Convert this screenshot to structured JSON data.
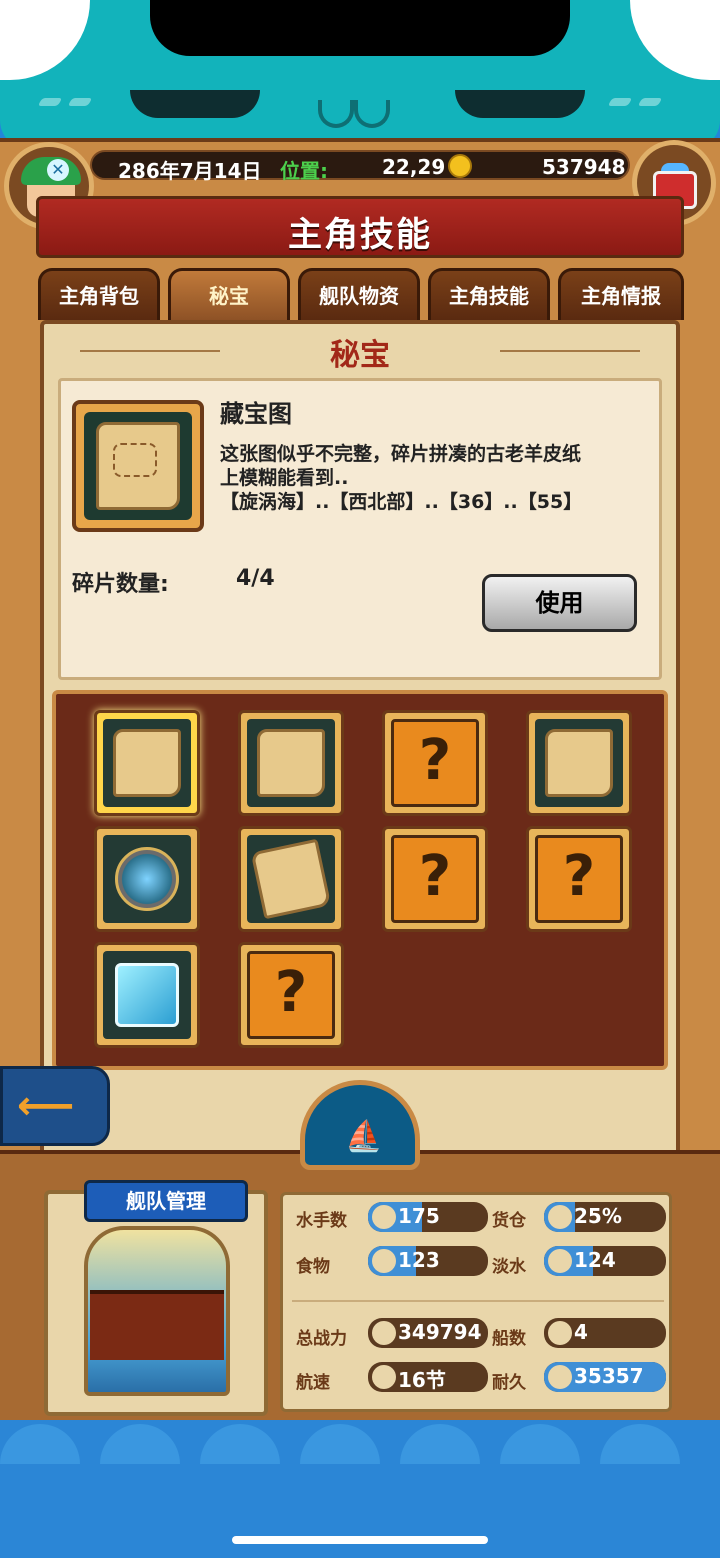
{
  "topbar": {
    "date": "286年7月14日",
    "position_label": "位置:",
    "position_value": "22,29",
    "gold": "537948"
  },
  "title": "主角技能",
  "tabs": [
    {
      "label": "主角背包",
      "active": false
    },
    {
      "label": "秘宝",
      "active": true
    },
    {
      "label": "舰队物资",
      "active": false
    },
    {
      "label": "主角技能",
      "active": false
    },
    {
      "label": "主角情报",
      "active": false
    }
  ],
  "section_title": "秘宝",
  "item": {
    "name": "藏宝图",
    "desc_lines": [
      "这张图似乎不完整，碎片拼凑的古老羊皮纸",
      "上模糊能看到..",
      "【旋涡海】..【西北部】..【36】..【55】"
    ],
    "count_label": "碎片数量:",
    "count_value": "4/4",
    "use_button": "使用"
  },
  "inventory": [
    {
      "icon": "treasure-map-icon",
      "selected": true
    },
    {
      "icon": "treasure-map-icon",
      "selected": false
    },
    {
      "icon": "unknown-icon",
      "selected": false
    },
    {
      "icon": "treasure-map-icon",
      "selected": false
    },
    {
      "icon": "compass-icon",
      "selected": false
    },
    {
      "icon": "map-fragment-icon",
      "selected": false
    },
    {
      "icon": "unknown-icon",
      "selected": false
    },
    {
      "icon": "unknown-icon",
      "selected": false
    },
    {
      "icon": "ice-cube-icon",
      "selected": false
    },
    {
      "icon": "unknown-icon",
      "selected": false
    }
  ],
  "unknown_glyph": "?",
  "back_icon": "arrow-left-icon",
  "fleet": {
    "banner": "舰队管理",
    "stats": [
      {
        "label": "水手数",
        "value": "175",
        "fill": 0.45,
        "icon": "sailor-icon"
      },
      {
        "label": "货仓",
        "value": "25%",
        "fill": 0.25,
        "icon": "crate-icon"
      },
      {
        "label": "食物",
        "value": "123",
        "fill": 0.4,
        "icon": "meat-icon"
      },
      {
        "label": "淡水",
        "value": "124",
        "fill": 0.4,
        "icon": "water-icon"
      },
      {
        "label": "总战力",
        "value": "349794",
        "fill": 0.0,
        "icon": "crossed-swords-icon"
      },
      {
        "label": "船数",
        "value": "4",
        "fill": 0.0,
        "icon": "ship-count-icon"
      },
      {
        "label": "航速",
        "value": "16节",
        "fill": 0.0,
        "icon": "boat-speed-icon"
      },
      {
        "label": "耐久",
        "value": "35357",
        "fill": 1.0,
        "icon": "durability-icon"
      }
    ]
  },
  "colors": {
    "accent_red": "#a22818",
    "wood": "#c98a45",
    "fill_blue": "#3f8fd6"
  }
}
